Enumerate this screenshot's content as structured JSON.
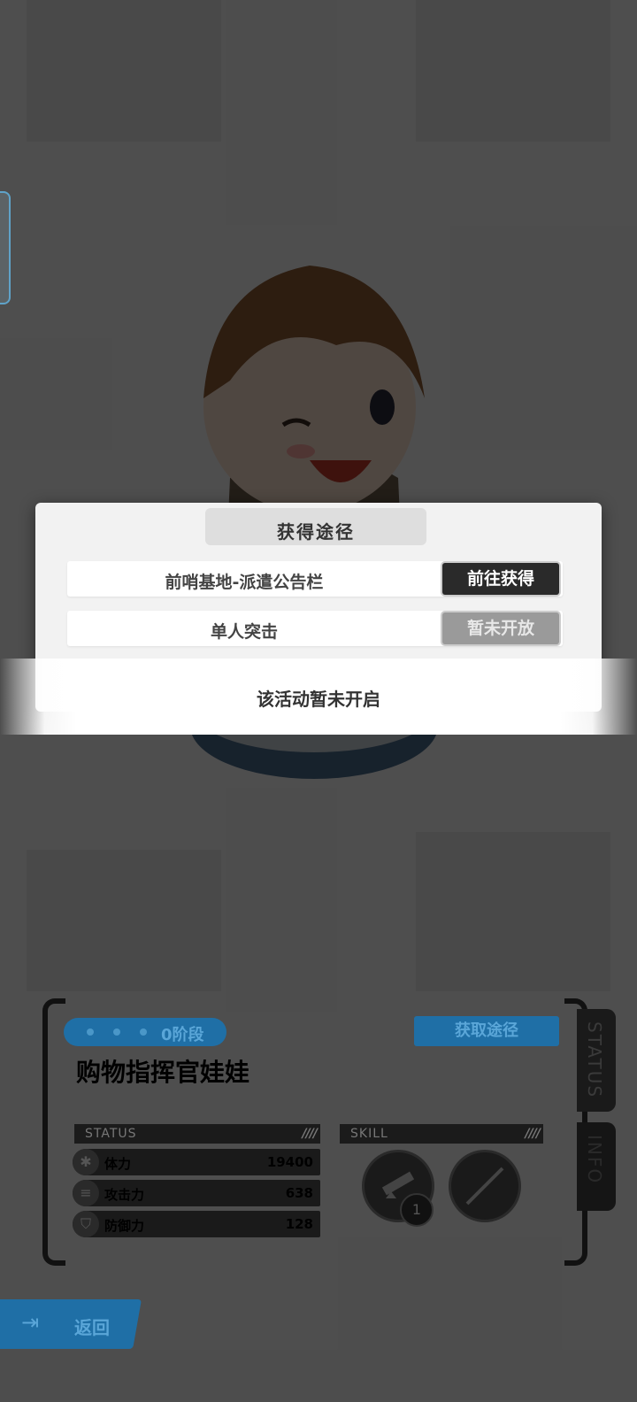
{
  "dialog": {
    "title": "获得途径",
    "routes": [
      {
        "label": "前哨基地-派遣公告栏",
        "button": "前往获得",
        "available": true
      },
      {
        "label": "单人突击",
        "button": "暂未开放",
        "available": false
      }
    ]
  },
  "toast": {
    "message": "该活动暂未开启"
  },
  "item_panel": {
    "stage": "0阶段",
    "get_route_button": "获取途径",
    "name": "购物指挥官娃娃",
    "status_header": "STATUS",
    "skill_header": "SKILL",
    "stats": [
      {
        "label": "体力",
        "value": "19400",
        "icon": "asterisk-icon"
      },
      {
        "label": "攻击力",
        "value": "638",
        "icon": "attack-icon"
      },
      {
        "label": "防御力",
        "value": "128",
        "icon": "shield-icon"
      }
    ],
    "skill_level": "1"
  },
  "side_tabs": {
    "status": "STATUS",
    "info": "INFO"
  },
  "back_button": {
    "label": "返回"
  },
  "colors": {
    "accent_blue": "#1f6fa6",
    "dark": "#1a1a1a"
  }
}
